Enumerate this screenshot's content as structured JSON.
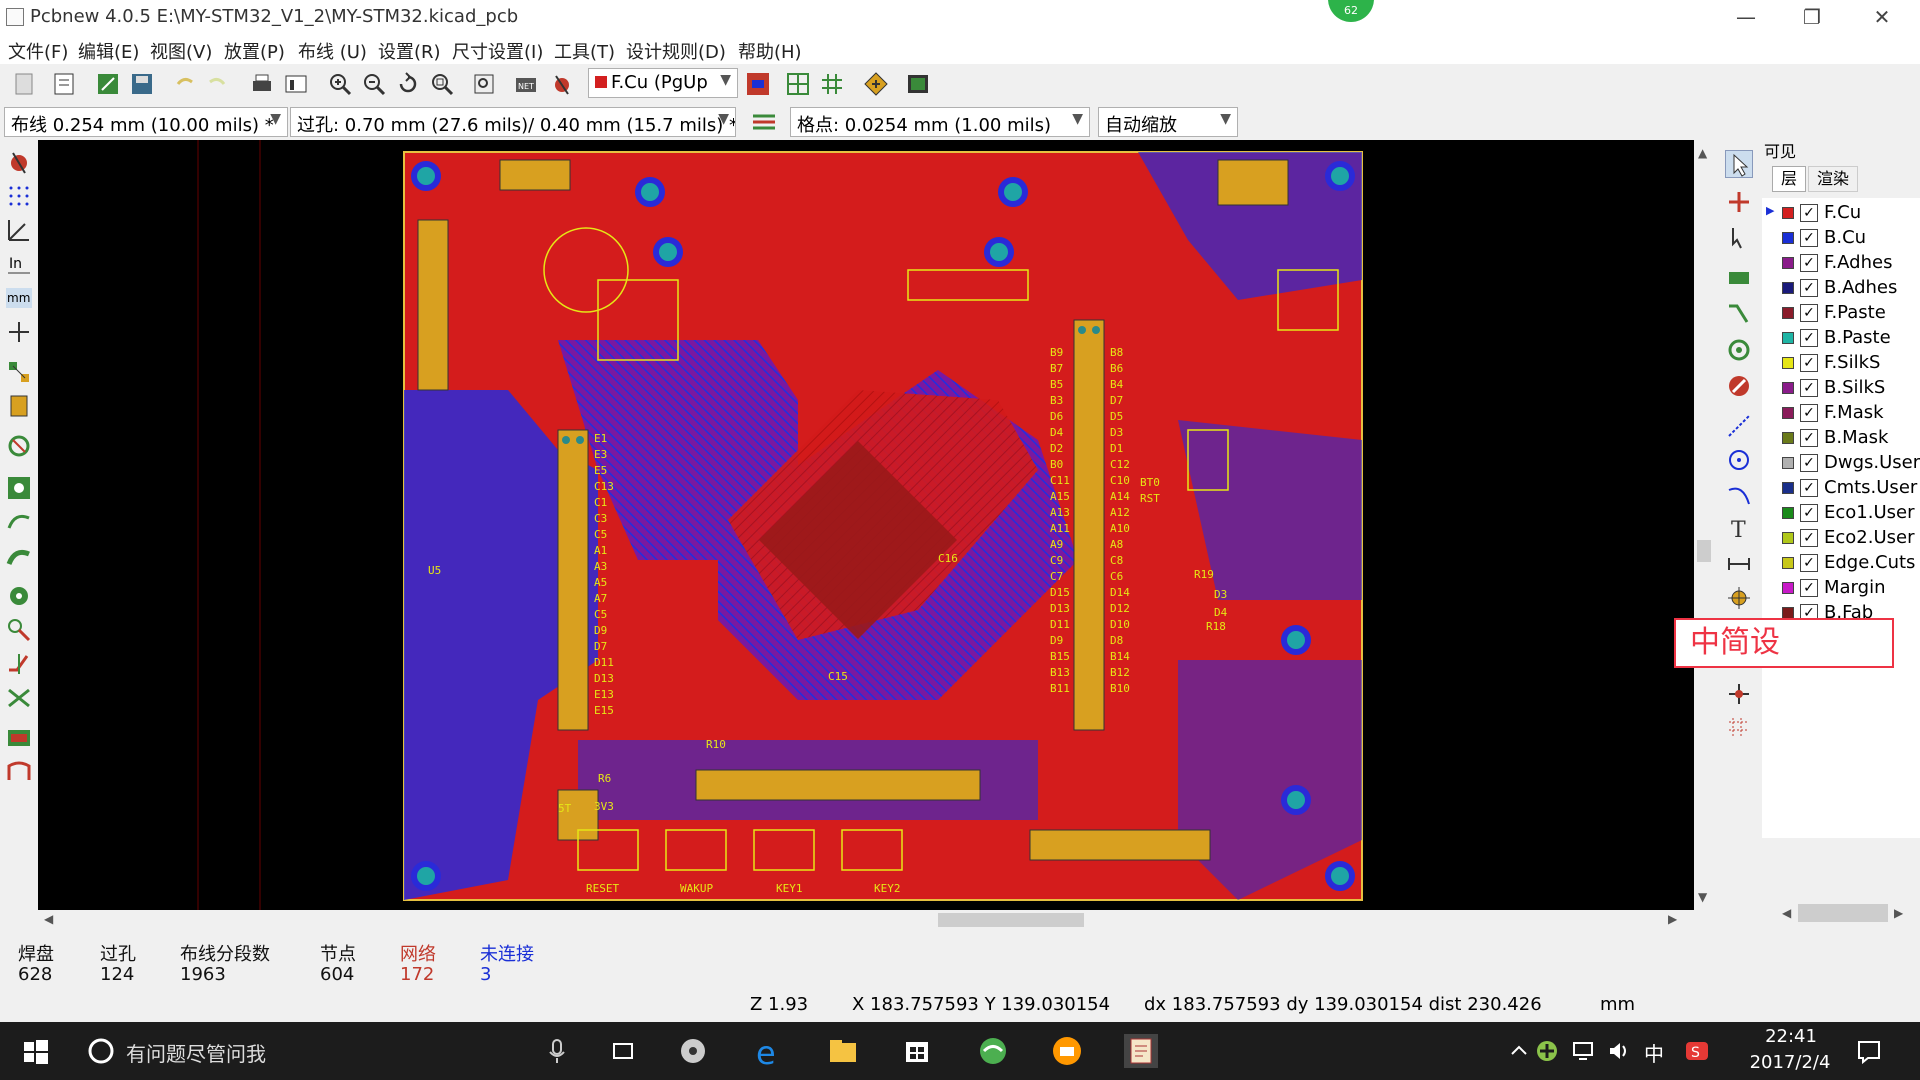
{
  "window": {
    "title": "Pcbnew 4.0.5 E:\\MY-STM32_V1_2\\MY-STM32.kicad_pcb",
    "badge": "62",
    "minimize": "—",
    "restore": "❐",
    "close": "✕"
  },
  "menu": [
    "文件(F)",
    "编辑(E)",
    "视图(V)",
    "放置(P)",
    "布线 (U)",
    "设置(R)",
    "尺寸设置(I)",
    "工具(T)",
    "设计规则(D)",
    "帮助(H)"
  ],
  "toolbar": {
    "layer_select": "F.Cu (PgUp",
    "track_width": "布线 0.254 mm (10.00 mils) *",
    "via_size": "过孔: 0.70 mm (27.6 mils)/ 0.40 mm (15.7 mils) *",
    "grid": "格点: 0.0254 mm (1.00 mils)",
    "zoom": "自动缩放"
  },
  "layers_panel": {
    "title": "可见",
    "tabs": [
      "层",
      "渲染"
    ],
    "items": [
      {
        "name": "F.Cu",
        "color": "#d32020",
        "checked": true,
        "active": true
      },
      {
        "name": "B.Cu",
        "color": "#1a2fd6",
        "checked": true
      },
      {
        "name": "F.Adhes",
        "color": "#8a1c8a",
        "checked": true
      },
      {
        "name": "B.Adhes",
        "color": "#1a1a7a",
        "checked": true
      },
      {
        "name": "F.Paste",
        "color": "#8a1c2a",
        "checked": true
      },
      {
        "name": "B.Paste",
        "color": "#1fb5a5",
        "checked": true
      },
      {
        "name": "F.SilkS",
        "color": "#e6e616",
        "checked": true
      },
      {
        "name": "B.SilkS",
        "color": "#8a1c8a",
        "checked": true
      },
      {
        "name": "F.Mask",
        "color": "#8a1c5a",
        "checked": true
      },
      {
        "name": "B.Mask",
        "color": "#6a7a1a",
        "checked": true
      },
      {
        "name": "Dwgs.User",
        "color": "#b0b0b0",
        "checked": true
      },
      {
        "name": "Cmts.User",
        "color": "#1a2f8a",
        "checked": true
      },
      {
        "name": "Eco1.User",
        "color": "#1a8a1a",
        "checked": true
      },
      {
        "name": "Eco2.User",
        "color": "#b0c81a",
        "checked": true
      },
      {
        "name": "Edge.Cuts",
        "color": "#c8c81a",
        "checked": true
      },
      {
        "name": "Margin",
        "color": "#c81ac8",
        "checked": true
      },
      {
        "name": "B.Fab",
        "color": "#7a1a1a",
        "checked": true
      }
    ]
  },
  "stats": {
    "labels": [
      "焊盘",
      "过孔",
      "布线分段数",
      "节点",
      "网络",
      "未连接"
    ],
    "values": [
      "628",
      "124",
      "1963",
      "604",
      "172",
      "3"
    ]
  },
  "status": {
    "zoom": "Z 1.93",
    "xy": "X 183.757593  Y 139.030154",
    "delta": "dx 183.757593  dy 139.030154  dist 230.426",
    "units": "mm"
  },
  "taskbar": {
    "search": "有问题尽管问我",
    "time": "22:41",
    "date": "2017/2/4",
    "ime": "中"
  },
  "watermark": "中简设",
  "board_labels": {
    "left_header": [
      "E1",
      "E3",
      "E5",
      "C13",
      "C1",
      "C3",
      "C5",
      "A1",
      "A3",
      "A5",
      "A7",
      "C5",
      "D9",
      "D7",
      "D11",
      "D13",
      "E13",
      "E15"
    ],
    "right_header": [
      "B9",
      "B7",
      "B5",
      "B3",
      "D6",
      "D4",
      "D2",
      "B0",
      "C11",
      "A15",
      "A13",
      "A11",
      "A9",
      "C9",
      "C7",
      "D15",
      "D13",
      "D11",
      "D9",
      "B15",
      "B13",
      "B11"
    ],
    "right_header2": [
      "B8",
      "B6",
      "B4",
      "D7",
      "D5",
      "D3",
      "D1",
      "C12",
      "C10",
      "A14",
      "A12",
      "A10",
      "A8",
      "C8",
      "C6",
      "D14",
      "D12",
      "D10",
      "D8",
      "B14",
      "B12",
      "B10"
    ],
    "refs": [
      "RESET",
      "WAKUP",
      "KEY1",
      "KEY2",
      "R6",
      "R10",
      "C15",
      "C16",
      "R19",
      "R18",
      "D3",
      "D4",
      "BT0",
      "RST",
      "U5",
      "3V3",
      "5T"
    ]
  }
}
